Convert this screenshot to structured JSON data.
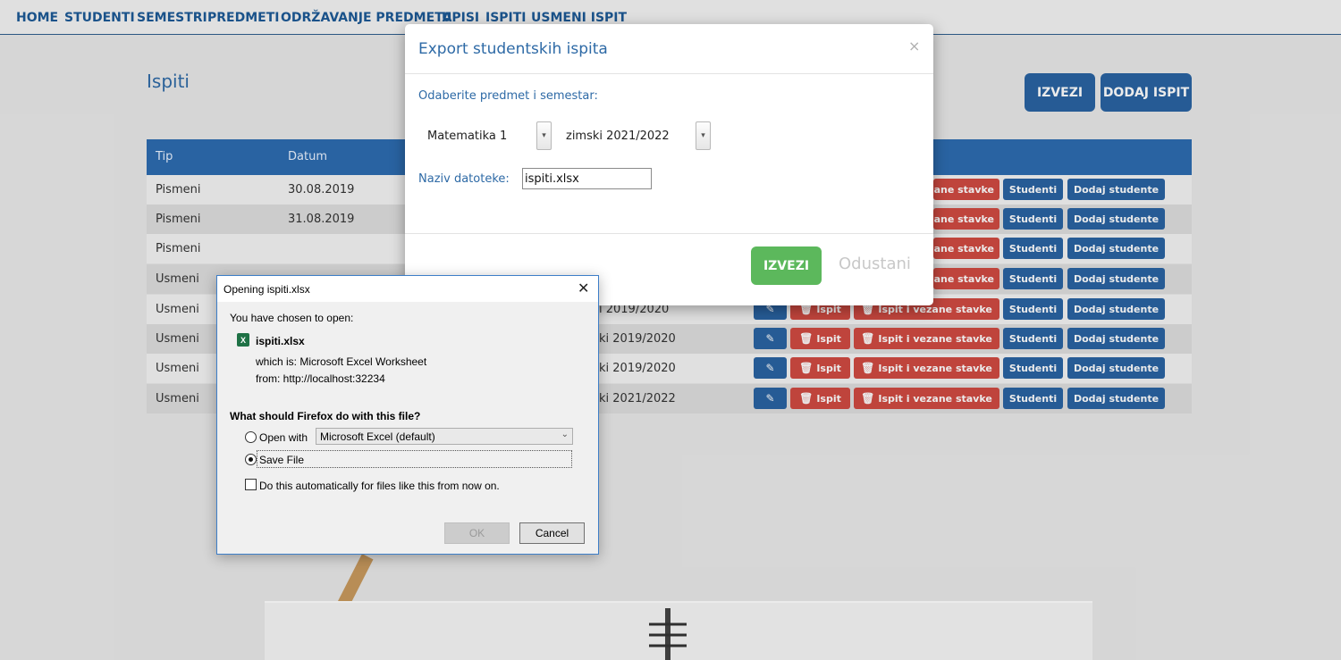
{
  "nav": {
    "items": [
      "HOME",
      "STUDENTI",
      "SEMESTRI",
      "PREDMETI",
      "ODRŽAVANJE PREDMETA",
      "UPISI",
      "ISPITI",
      "USMENI ISPIT"
    ]
  },
  "page": {
    "title": "Ispiti",
    "export_button": "IZVEZI",
    "add_button": "DODAJ ISPIT"
  },
  "table": {
    "headers": [
      "Tip",
      "Datum"
    ],
    "rows": [
      {
        "tip": "Pismeni",
        "datum": "30.08.2019",
        "semestar": ""
      },
      {
        "tip": "Pismeni",
        "datum": "31.08.2019",
        "semestar": ""
      },
      {
        "tip": "Pismeni",
        "datum": "",
        "semestar": ""
      },
      {
        "tip": "Usmeni",
        "datum": "",
        "semestar": ""
      },
      {
        "tip": "Usmeni",
        "datum": "",
        "semestar": "i 2019/2020"
      },
      {
        "tip": "Usmeni",
        "datum": "",
        "semestar": "ki 2019/2020"
      },
      {
        "tip": "Usmeni",
        "datum": "",
        "semestar": "ki 2019/2020"
      },
      {
        "tip": "Usmeni",
        "datum": "",
        "semestar": "ki 2021/2022"
      }
    ],
    "actions": {
      "delete": "Ispit",
      "delete_related": "Ispit i vezane stavke",
      "delete_related_partial": "zane stavke",
      "students": "Studenti",
      "add_students": "Dodaj studente"
    }
  },
  "export_modal": {
    "title": "Export studentskih ispita",
    "close": "×",
    "prompt": "Odaberite predmet i semestar:",
    "subject": "Matematika 1",
    "semester": "zimski 2021/2022",
    "filename_label": "Naziv datoteke:",
    "filename_value": "ispiti.xlsx",
    "confirm": "IZVEZI",
    "cancel": "Odustani"
  },
  "download_dialog": {
    "title": "Opening ispiti.xlsx",
    "close": "✕",
    "intro": "You have chosen to open:",
    "filename": "ispiti.xlsx",
    "which_is": "which is: Microsoft Excel Worksheet",
    "from": "from: http://localhost:32234",
    "question": "What should Firefox do with this file?",
    "open_with_label": "Open with",
    "open_with_app": "Microsoft Excel (default)",
    "save_file_label": "Save File",
    "auto_label": "Do this automatically for files like this from now on.",
    "ok": "OK",
    "cancel": "Cancel"
  }
}
